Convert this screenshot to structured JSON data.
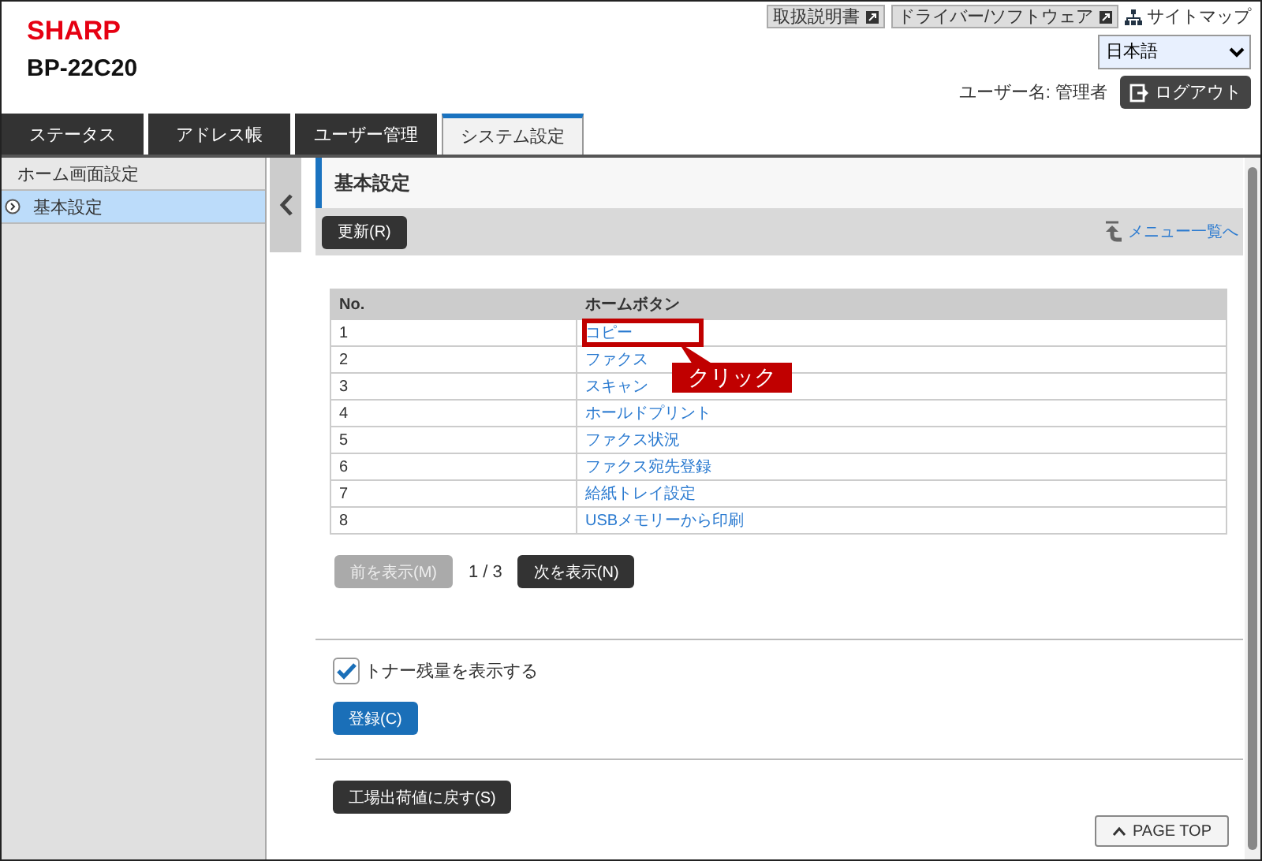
{
  "logo": "SHARP",
  "model": "BP-22C20",
  "top_links": [
    {
      "label": "取扱説明書",
      "kind": "external"
    },
    {
      "label": "ドライバー/ソフトウェア",
      "kind": "external"
    },
    {
      "label": "サイトマップ",
      "kind": "sitemap"
    }
  ],
  "language": {
    "value": "日本語"
  },
  "user": "ユーザー名: 管理者",
  "logout": "ログアウト",
  "tabs": [
    {
      "label": "ステータス",
      "selected": false
    },
    {
      "label": "アドレス帳",
      "selected": false
    },
    {
      "label": "ユーザー管理",
      "selected": false
    },
    {
      "label": "システム設定",
      "selected": true
    }
  ],
  "sidebar": {
    "items": [
      {
        "label": "ホーム画面設定",
        "selected": false,
        "children": [
          {
            "label": "基本設定",
            "selected": true
          }
        ]
      }
    ]
  },
  "page": {
    "title": "基本設定",
    "refresh_button": "更新(R)",
    "menu_link": "メニュー一覧へ"
  },
  "table": {
    "columns": [
      "No.",
      "ホームボタン"
    ],
    "rows": [
      {
        "no": "1",
        "button": "コピー",
        "highlighted": true
      },
      {
        "no": "2",
        "button": "ファクス",
        "highlighted": false
      },
      {
        "no": "3",
        "button": "スキャン",
        "highlighted": false
      },
      {
        "no": "4",
        "button": "ホールドプリント",
        "highlighted": false
      },
      {
        "no": "5",
        "button": "ファクス状況",
        "highlighted": false
      },
      {
        "no": "6",
        "button": "ファクス宛先登録",
        "highlighted": false
      },
      {
        "no": "7",
        "button": "給紙トレイ設定",
        "highlighted": false
      },
      {
        "no": "8",
        "button": "USBメモリーから印刷",
        "highlighted": false
      }
    ]
  },
  "annotation": {
    "text": "クリック"
  },
  "pagination": {
    "prev": {
      "label": "前を表示(M)",
      "disabled": true
    },
    "page": "1 / 3",
    "next": {
      "label": "次を表示(N)",
      "disabled": false
    }
  },
  "toner_checkbox": {
    "label": "トナー残量を表示する",
    "checked": true
  },
  "register_button": "登録(C)",
  "reset_button": "工場出荷値に戻す(S)",
  "page_top": "PAGE TOP"
}
